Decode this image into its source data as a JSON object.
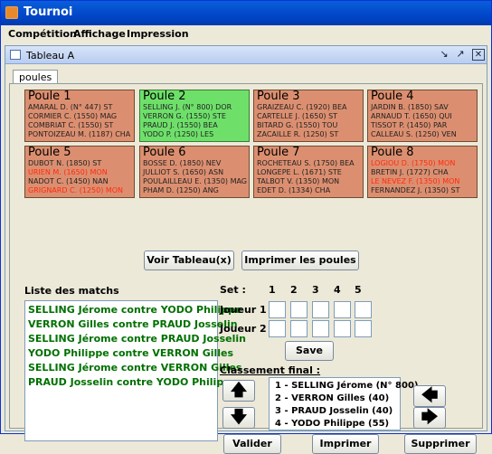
{
  "window": {
    "title": "Tournoi"
  },
  "menu": {
    "items": [
      "Compétition",
      "Affichage",
      "Impression"
    ]
  },
  "internal_frame": {
    "title": "Tableau A"
  },
  "tabs": [
    {
      "label": "poules"
    }
  ],
  "poules": [
    {
      "name": "Poule 1",
      "players": [
        {
          "text": "AMARAL D. (N° 447) ST",
          "highlight": false
        },
        {
          "text": "CORMIER C. (1550) MAG",
          "highlight": false
        },
        {
          "text": "COMBRIAT C. (1550) ST",
          "highlight": false
        },
        {
          "text": "PONTOIZEAU M. (1187) CHA",
          "highlight": false
        }
      ]
    },
    {
      "name": "Poule 2",
      "players": [
        {
          "text": "SELLING J. (N° 800) DOR",
          "highlight": false
        },
        {
          "text": "VERRON G. (1550) STE",
          "highlight": false
        },
        {
          "text": "PRAUD J. (1550) BEA",
          "highlight": false
        },
        {
          "text": "YODO P. (1250) LES",
          "highlight": false
        }
      ]
    },
    {
      "name": "Poule 3",
      "players": [
        {
          "text": "GRAIZEAU C. (1920) BEA",
          "highlight": false
        },
        {
          "text": "CARTELLE J. (1650) ST",
          "highlight": false
        },
        {
          "text": "BITARD G. (1550) TOU",
          "highlight": false
        },
        {
          "text": "ZACAILLE R. (1250) ST",
          "highlight": false
        }
      ]
    },
    {
      "name": "Poule 4",
      "players": [
        {
          "text": "JARDIN B. (1850) SAV",
          "highlight": false
        },
        {
          "text": "ARNAUD T. (1650) QUI",
          "highlight": false
        },
        {
          "text": "TISSOT P. (1450) PAR",
          "highlight": false
        },
        {
          "text": "CALLEAU S. (1250) VEN",
          "highlight": false
        }
      ]
    },
    {
      "name": "Poule 5",
      "players": [
        {
          "text": "DUBOT N. (1850) ST",
          "highlight": false
        },
        {
          "text": "URIEN M. (1650) MON",
          "highlight": true
        },
        {
          "text": "NADOT C. (1450) NAN",
          "highlight": false
        },
        {
          "text": "GRIGNARD C. (1250) MON",
          "highlight": true
        }
      ]
    },
    {
      "name": "Poule 6",
      "players": [
        {
          "text": "BOSSE D. (1850) NEV",
          "highlight": false
        },
        {
          "text": "JULLIOT S. (1650) ASN",
          "highlight": false
        },
        {
          "text": "POULAILLEAU E. (1350) MAG",
          "highlight": false
        },
        {
          "text": "PHAM D. (1250) ANG",
          "highlight": false
        }
      ]
    },
    {
      "name": "Poule 7",
      "players": [
        {
          "text": "ROCHETEAU S. (1750) BEA",
          "highlight": false
        },
        {
          "text": "LONGEPE L. (1671) STE",
          "highlight": false
        },
        {
          "text": "TALBOT V. (1350) MON",
          "highlight": false
        },
        {
          "text": "EDET D. (1334) CHA",
          "highlight": false
        }
      ]
    },
    {
      "name": "Poule 8",
      "players": [
        {
          "text": "LOGIOU D. (1750) MON",
          "highlight": true
        },
        {
          "text": "BRETIN J. (1727) CHA",
          "highlight": false
        },
        {
          "text": "LE NEVEZ F. (1350) MON",
          "highlight": true
        },
        {
          "text": "FERNANDEZ J. (1350) ST",
          "highlight": false
        }
      ]
    }
  ],
  "buttons": {
    "voir_tableau": "Voir Tableau(x)",
    "imprimer_poules": "Imprimer les poules",
    "save": "Save",
    "valider": "Valider",
    "imprimer": "Imprimer",
    "supprimer": "Supprimer"
  },
  "matches": {
    "label": "Liste des matchs",
    "items": [
      "SELLING Jérome contre YODO Philippe",
      "VERRON Gilles contre PRAUD Josselin",
      "SELLING Jérome contre PRAUD Josselin",
      "YODO Philippe contre VERRON Gilles",
      "SELLING Jérome contre VERRON Gilles",
      "PRAUD Josselin contre YODO Philippe"
    ]
  },
  "sets": {
    "label": "Set :",
    "numbers": [
      "1",
      "2",
      "3",
      "4",
      "5"
    ],
    "joueur1": "Joueur 1 :",
    "joueur2": "Joueur 2 :"
  },
  "classement": {
    "label": "Classement final :",
    "items": [
      "1 - SELLING Jérome (N° 800)",
      "2 - VERRON Gilles (40)",
      "3 - PRAUD Josselin (40)",
      "4 - YODO Philippe (55)"
    ]
  },
  "icons": {
    "up": "arrow-up-icon",
    "down": "arrow-down-icon",
    "left": "arrow-left-icon",
    "right": "arrow-right-icon"
  },
  "colors": {
    "poule_default": "#dc8f70",
    "poule_selected": "#6ee06a",
    "match_text": "#007000",
    "highlight_text": "#ff2a0e",
    "titlebar": "#0046c8"
  }
}
